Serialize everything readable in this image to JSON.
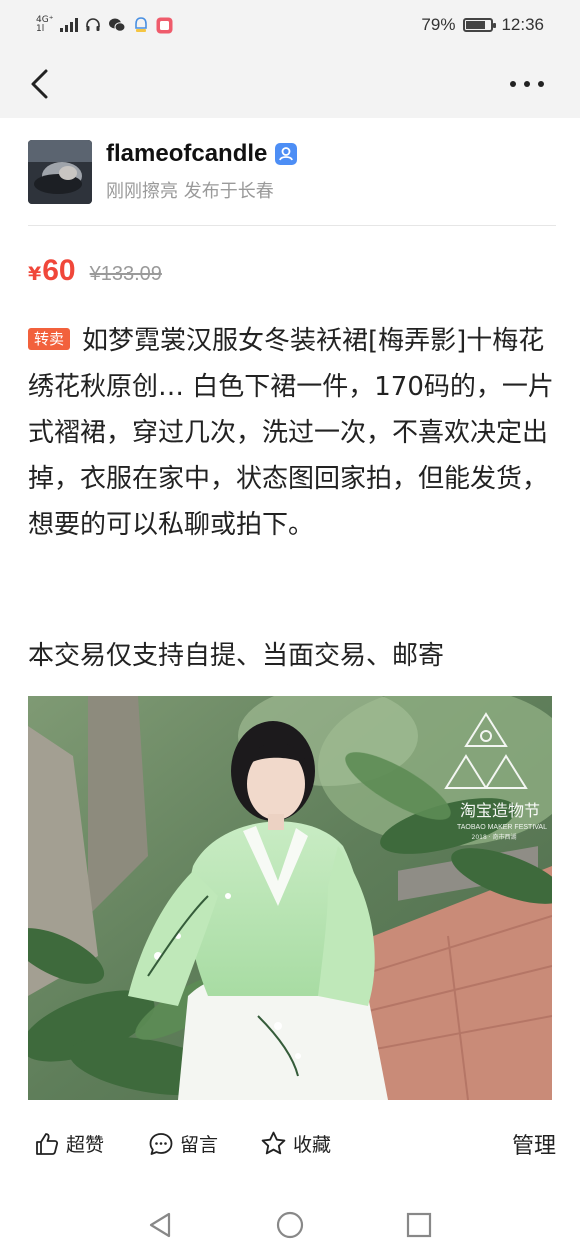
{
  "status_bar": {
    "network_top": "4G⁺",
    "network_bottom": "1l",
    "battery_percent": "79%",
    "battery_level": 0.79,
    "time": "12:36"
  },
  "header": {
    "back_icon": "chevron-left-icon",
    "more_icon": "more-dots-icon"
  },
  "user": {
    "name": "flameofcandle",
    "subtitle": "刚刚擦亮 发布于长春",
    "verified_icon": "verified-badge-icon"
  },
  "price": {
    "currency": "¥",
    "current": "60",
    "original": "¥133.09",
    "color": "#f0473a"
  },
  "post": {
    "tag": "转卖",
    "tag_color": "#f2613c",
    "description": "如梦霓裳汉服女冬装袄裙[梅弄影]十梅花绣花秋原创… 白色下裙一件，170码的，一片式褶裙，穿过几次，洗过一次，不喜欢决定出掉，衣服在家中，状态图回家拍，但能发货，想要的可以私聊或拍下。",
    "trade_methods": "本交易仅支持自提、当面交易、邮寄"
  },
  "photo": {
    "watermark_title": "淘宝造物节",
    "watermark_sub": "TAOBAO MAKER FESTIVAL",
    "watermark_year": "2018 · 奇市西湖"
  },
  "actions": {
    "like": "超赞",
    "comment": "留言",
    "favorite": "收藏",
    "manage": "管理"
  }
}
